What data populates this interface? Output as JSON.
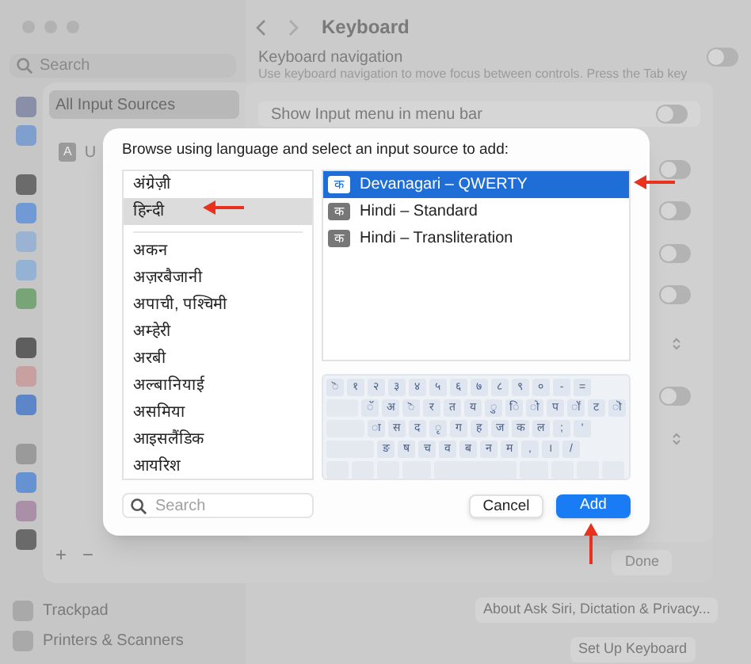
{
  "window": {
    "title": "Keyboard"
  },
  "sidebar": {
    "search": {
      "placeholder": "Search"
    },
    "items": [
      {
        "label": "Trackpad"
      },
      {
        "label": "Printers & Scanners"
      }
    ]
  },
  "main": {
    "section_title": "Keyboard navigation",
    "description": "Use keyboard navigation to move focus between controls. Press the Tab key",
    "toggles": [
      {
        "on": false
      }
    ],
    "buttons": [
      "About Ask Siri, Dictation & Privacy...",
      "Set Up Keyboard"
    ]
  },
  "sheet": {
    "list": [
      {
        "label": "All Input Sources",
        "selected": true
      },
      {
        "badge": "A",
        "label": "U",
        "selected": false
      }
    ],
    "setting": "Show Input menu in menu bar",
    "toggles": [
      {
        "on": false
      },
      {
        "on": false
      },
      {
        "on": false
      },
      {
        "on": false
      },
      {
        "on": false
      },
      {
        "on": false
      }
    ],
    "add": "+",
    "remove": "−",
    "done": "Done"
  },
  "dialog": {
    "title": "Browse using language and select an input source to add:",
    "preferred_languages": [
      {
        "label": "अंग्रेज़ी",
        "selected": false
      },
      {
        "label": "हिन्दी",
        "selected": true
      }
    ],
    "languages": [
      {
        "label": "अकन",
        "selected": false
      },
      {
        "label": "अज़रबैजानी",
        "selected": false
      },
      {
        "label": "अपाची, पश्चिमी",
        "selected": false
      },
      {
        "label": "अम्हेरी",
        "selected": false
      },
      {
        "label": "अरबी",
        "selected": false
      },
      {
        "label": "अल्बानियाई",
        "selected": false
      },
      {
        "label": "असमिया",
        "selected": false
      },
      {
        "label": "आइसलैंडिक",
        "selected": false
      },
      {
        "label": "आयरिश",
        "selected": false
      }
    ],
    "sources": [
      {
        "badge": "क",
        "label": "Devanagari – QWERTY",
        "selected": true
      },
      {
        "badge": "क",
        "label": "Hindi – Standard",
        "selected": false
      },
      {
        "badge": "क",
        "label": "Hindi – Transliteration",
        "selected": false
      }
    ],
    "keyboard_rows": [
      [
        "ॆ",
        "१",
        "२",
        "३",
        "४",
        "५",
        "६",
        "७",
        "८",
        "९",
        "०",
        "-",
        "="
      ],
      [
        "ॅ",
        "अ",
        "ॆ",
        "र",
        "त",
        "य",
        "ु",
        "ि",
        "ो",
        "प",
        "ॉ",
        "ट",
        "ॊ"
      ],
      [
        "ा",
        "स",
        "द",
        "ृ",
        "ग",
        "ह",
        "ज",
        "क",
        "ल",
        ";",
        "'"
      ],
      [
        "ङ",
        "ष",
        "च",
        "व",
        "ब",
        "न",
        "म",
        ",",
        "।",
        "/"
      ]
    ],
    "search": {
      "placeholder": "Search"
    },
    "buttons": [
      {
        "label": "Cancel",
        "kind": "secondary"
      },
      {
        "label": "Add",
        "kind": "primary"
      }
    ]
  },
  "annotations": [
    {
      "kind": "arrow-left"
    },
    {
      "kind": "arrow-left"
    },
    {
      "kind": "arrow-up"
    }
  ]
}
